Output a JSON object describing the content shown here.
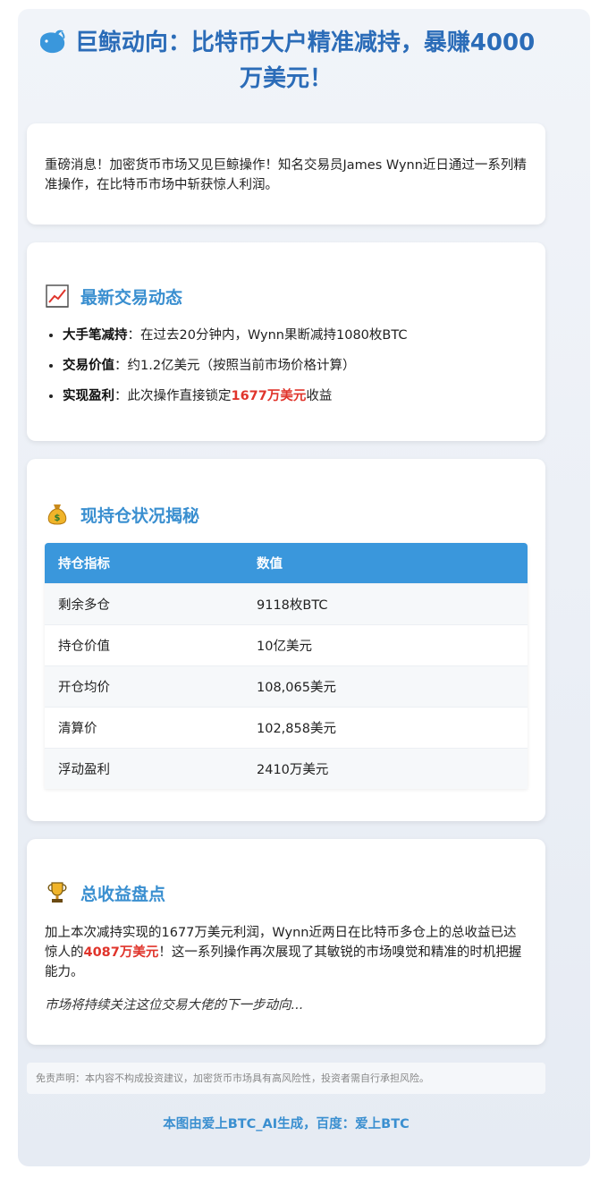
{
  "title": "巨鲸动向：比特币大户精准减持，暴赚4000万美元！",
  "intro": "重磅消息！加密货币市场又见巨鲸操作！知名交易员James Wynn近日通过一系列精准操作，在比特币市场中斩获惊人利润。",
  "trades": {
    "heading": "最新交易动态",
    "items": [
      {
        "label": "大手笔减持",
        "text": "：在过去20分钟内，Wynn果断减持1080枚BTC"
      },
      {
        "label": "交易价值",
        "text": "：约1.2亿美元（按照当前市场价格计算）"
      },
      {
        "label": "实现盈利",
        "text_before": "：此次操作直接锁定",
        "highlight": "1677万美元",
        "text_after": "收益"
      }
    ]
  },
  "holdings": {
    "heading": "现持仓状况揭秘",
    "col1": "持仓指标",
    "col2": "数值",
    "rows": [
      {
        "k": "剩余多仓",
        "v": "9118枚BTC"
      },
      {
        "k": "持仓价值",
        "v": "10亿美元"
      },
      {
        "k": "开仓均价",
        "v": "108,065美元"
      },
      {
        "k": "清算价",
        "v": "102,858美元"
      },
      {
        "k": "浮动盈利",
        "v": "2410万美元"
      }
    ]
  },
  "summary": {
    "heading": "总收益盘点",
    "p_before": "加上本次减持实现的1677万美元利润，Wynn近两日在比特币多仓上的总收益已达惊人的",
    "p_highlight": "4087万美元",
    "p_after": "！这一系列操作再次展现了其敏锐的市场嗅觉和精准的时机把握能力。",
    "italic": "市场将持续关注这位交易大佬的下一步动向..."
  },
  "disclaimer": "免责声明：本内容不构成投资建议，加密货币市场具有高风险性，投资者需自行承担风险。",
  "footer": "本图由爱上BTC_AI生成，百度：爱上BTC",
  "colors": {
    "accent": "#3a8fd0",
    "highlight": "#e0342b",
    "table_header": "#3a97dc"
  }
}
